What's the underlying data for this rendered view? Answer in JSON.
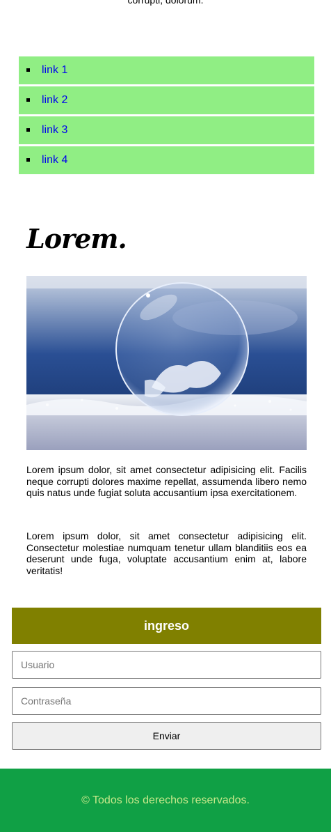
{
  "top_text": "corrupti, dolorum.",
  "nav": {
    "items": [
      {
        "label": "link 1"
      },
      {
        "label": "link 2"
      },
      {
        "label": "link 3"
      },
      {
        "label": "link 4"
      }
    ]
  },
  "article": {
    "title": "Lorem.",
    "paragraphs": [
      "Lorem ipsum dolor, sit amet consectetur adipisicing elit. Facilis neque corrupti dolores maxime repellat, assumenda libero nemo quis natus unde fugiat soluta accusantium ipsa exercitationem.",
      "Lorem ipsum dolor, sit amet consectetur adipisicing elit. Consectetur molestiae numquam tenetur ullam blanditiis eos ea deserunt unde fuga, voluptate accusantium enim at, labore veritatis!"
    ]
  },
  "login": {
    "heading": "ingreso",
    "user_placeholder": "Usuario",
    "password_placeholder": "Contraseña",
    "submit_label": "Enviar"
  },
  "footer": {
    "text": "© Todos los derechos reservados."
  },
  "colors": {
    "nav_bg": "#90ee84",
    "link": "#0000ee",
    "login_head_bg": "#808000",
    "footer_bg": "#10a045",
    "footer_text": "#c7e88a"
  }
}
